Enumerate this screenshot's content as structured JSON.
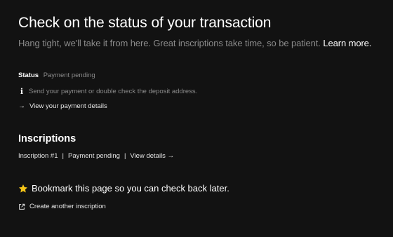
{
  "header": {
    "title": "Check on the status of your transaction",
    "subtitle": "Hang tight, we'll take it from here. Great inscriptions take time, so be patient.",
    "learn_more": "Learn more."
  },
  "status": {
    "label": "Status",
    "value": "Payment pending",
    "info_icon": "info-icon",
    "info_text": "Send your payment or double check the deposit address.",
    "details_link": "View your payment details"
  },
  "inscriptions": {
    "heading": "Inscriptions",
    "items": [
      {
        "name": "Inscription #1",
        "status": "Payment pending",
        "link": "View details →"
      }
    ]
  },
  "bookmark": {
    "icon": "star-icon",
    "text": "Bookmark this page so you can check back later."
  },
  "footer": {
    "create_icon": "external-link-icon",
    "create_link": "Create another inscription"
  },
  "colors": {
    "background": "#121212",
    "muted": "#8b8b8b",
    "star": "#f5c518"
  }
}
